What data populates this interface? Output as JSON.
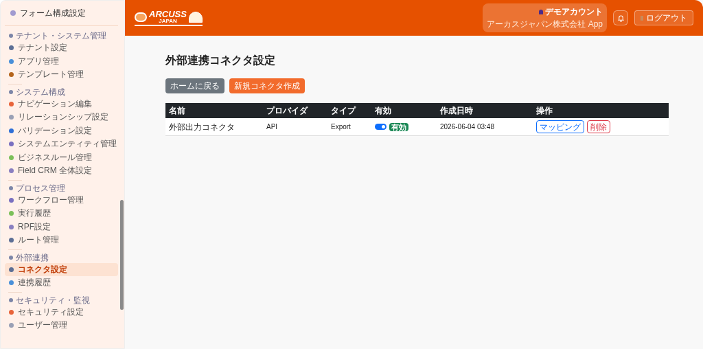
{
  "sidebar": {
    "title": "フォーム構成設定",
    "sections": [
      {
        "header": "テナント・システム管理",
        "items": [
          {
            "label": "テナント設定",
            "selected": false
          },
          {
            "label": "アプリ管理",
            "selected": false
          },
          {
            "label": "テンプレート管理",
            "selected": false
          }
        ]
      },
      {
        "header": "システム構成",
        "items": [
          {
            "label": "ナビゲーション編集",
            "selected": false
          },
          {
            "label": "リレーションシップ設定",
            "selected": false
          },
          {
            "label": "バリデーション設定",
            "selected": false
          },
          {
            "label": "システムエンティティ管理",
            "selected": false
          },
          {
            "label": "ビジネスルール管理",
            "selected": false
          },
          {
            "label": "Field CRM 全体設定",
            "selected": false
          }
        ]
      },
      {
        "header": "プロセス管理",
        "items": [
          {
            "label": "ワークフロー管理",
            "selected": false
          },
          {
            "label": "実行履歴",
            "selected": false
          },
          {
            "label": "RPF設定",
            "selected": false
          },
          {
            "label": "ルート管理",
            "selected": false
          }
        ]
      },
      {
        "header": "外部連携",
        "items": [
          {
            "label": "コネクタ設定",
            "selected": true
          },
          {
            "label": "連携履歴",
            "selected": false
          }
        ]
      },
      {
        "header": "セキュリティ・監視",
        "items": [
          {
            "label": "セキュリティ設定",
            "selected": false
          },
          {
            "label": "ユーザー管理",
            "selected": false
          }
        ]
      }
    ]
  },
  "header": {
    "logo_text": "ARCUSS",
    "logo_subtext": "JAPAN",
    "account_name": "デモアカウント",
    "account_org": "アーカスジャパン株式会社 App",
    "logout": "ログアウト"
  },
  "page": {
    "title": "外部連携コネクタ設定",
    "buttons": [
      "ホームに戻る",
      "新規コネクタ作成"
    ],
    "table": {
      "columns": [
        "名前",
        "プロバイダ",
        "タイプ",
        "有効",
        "作成日時",
        "操作"
      ],
      "rows": [
        {
          "name": "外部出力コネクタ",
          "provider": "API",
          "type": "Export",
          "enabled": true,
          "status_badge": "有効",
          "created": "2026-06-04 03:48",
          "actions": [
            "マッピング",
            "削除"
          ]
        }
      ]
    }
  }
}
